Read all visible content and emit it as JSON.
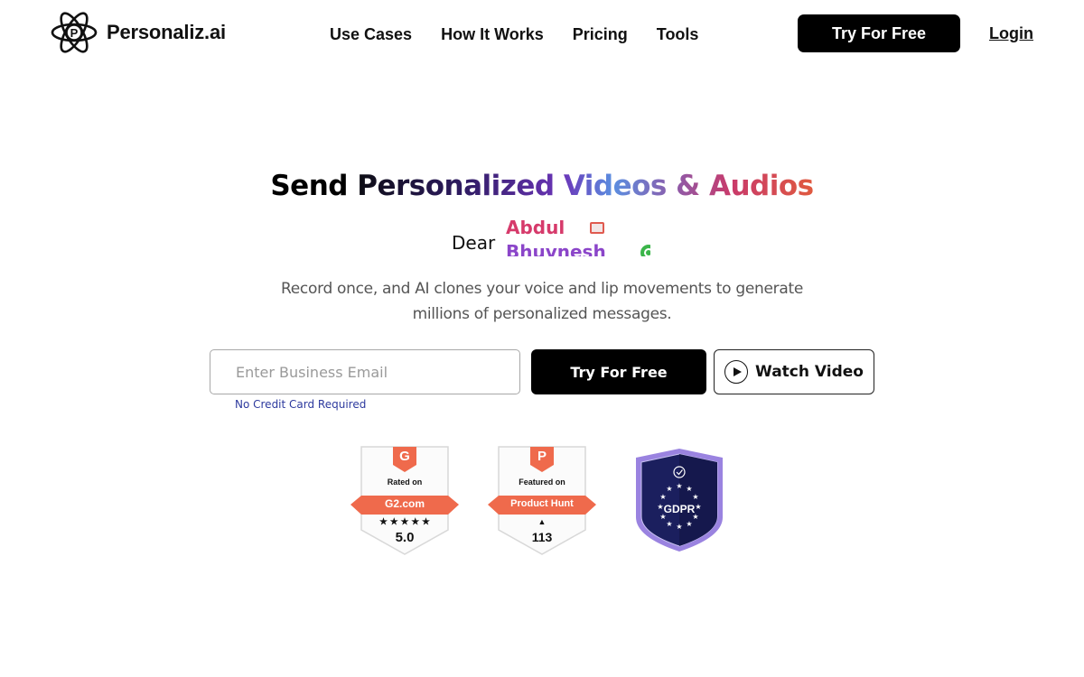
{
  "nav": {
    "brand": "Personaliz.ai",
    "logo_letter": "P",
    "menu": [
      {
        "label": "Use Cases"
      },
      {
        "label": "How It Works"
      },
      {
        "label": "Pricing"
      },
      {
        "label": "Tools"
      }
    ],
    "cta_label": "Try For Free",
    "login_label": "Login"
  },
  "hero": {
    "headline_plain": "Send ",
    "headline_gradient": "Personalized Videos & Audios",
    "dear_label": "Dear",
    "names": [
      {
        "text": "Abdul",
        "icon": "gmail-icon"
      },
      {
        "text": "Bhuvnesh",
        "icon": "whatsapp-icon"
      }
    ],
    "subtext": "Record once, and AI clones your voice and lip movements to generate millions of personalized messages.",
    "email_placeholder": "Enter Business Email",
    "email_value": "",
    "no_cc_note": "No Credit Card Required",
    "cta_label": "Try For Free",
    "watch_label": "Watch Video"
  },
  "badges": {
    "g2": {
      "logo": "G",
      "top_text": "Rated on",
      "ribbon": "G2.com",
      "stars": "★ ★ ★ ★ ★",
      "score": "5.0"
    },
    "producthunt": {
      "logo": "P",
      "top_text": "Featured on",
      "ribbon": "Product Hunt",
      "arrow": "▲",
      "score": "113"
    },
    "gdpr": {
      "label": "GDPR"
    }
  },
  "colors": {
    "primary": "#000000",
    "badge_orange": "#ef6a4c",
    "no_cc_blue": "#2d3a9e",
    "gdpr_navy": "#1b1f5e",
    "gdpr_border": "#9a83e0"
  }
}
